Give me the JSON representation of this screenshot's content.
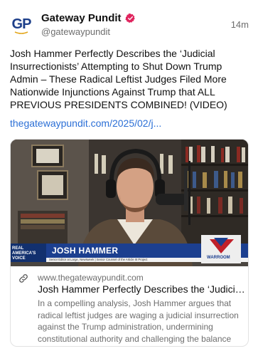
{
  "post": {
    "author": {
      "display_name": "Gateway Pundit",
      "handle": "@gatewaypundit",
      "avatar_text": "GP",
      "verified_icon": "verified-badge-icon"
    },
    "time": "14m",
    "text": "Josh Hammer Perfectly Describes the ‘Judicial Insurrectionists’ Attempting to Shut Down Trump Admin – These Radical Leftist Judges Filed More Nationwide Injunctions Against Trump that ALL PREVIOUS PRESIDENTS COMBINED! (VIDEO)",
    "link": "thegatewaypundit.com/2025/02/j...",
    "card": {
      "thumbnail": {
        "lower_third_logo": "REAL AMERICA'S VOICE",
        "lower_third_name": "JOSH HAMMER",
        "lower_third_subtitle": "Senior Editor at Large, Newsweek | Senior Counsel of the Article III Project",
        "show_logo": "WARROOM"
      },
      "domain": "www.thegatewaypundit.com",
      "title": "Josh Hammer Perfectly Describes the ‘Judicial Insurrectionists’",
      "description": "In a compelling analysis, Josh Hammer argues that radical leftist judges are waging a judicial insurrection against the Trump administration, undermining constitutional authority and challenging the balance o..."
    }
  },
  "colors": {
    "link": "#2b6fd6",
    "verified": "#e0245e",
    "brand": "#1d3f8a",
    "muted": "#6e6e6e"
  }
}
